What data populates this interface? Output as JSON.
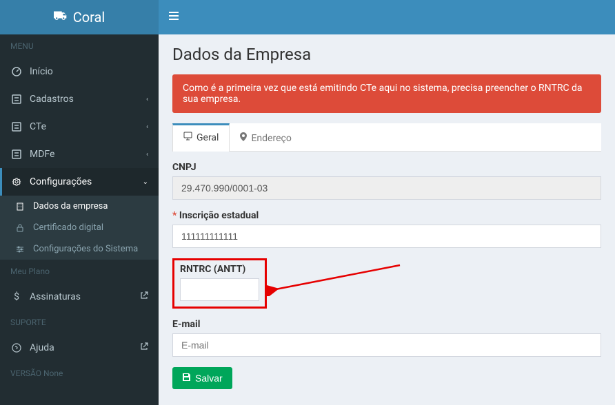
{
  "brand": "Coral",
  "sidebar": {
    "menu_label": "MENU",
    "items": {
      "inicio": "Início",
      "cadastros": "Cadastros",
      "cte": "CTe",
      "mdfe": "MDFe",
      "config": "Configurações"
    },
    "config_sub": {
      "dados": "Dados da empresa",
      "cert": "Certificado digital",
      "sys": "Configurações do Sistema"
    },
    "plano_label": "Meu Plano",
    "assinaturas": "Assinaturas",
    "suporte_label": "SUPORTE",
    "ajuda": "Ajuda",
    "version": "VERSÃO None"
  },
  "page": {
    "title": "Dados da Empresa",
    "alert": "Como é a primeira vez que está emitindo CTe aqui no sistema, precisa preencher o RNTRC da sua empresa."
  },
  "tabs": {
    "geral": "Geral",
    "endereco": "Endereço"
  },
  "form": {
    "cnpj_label": "CNPJ",
    "cnpj_value": "29.470.990/0001-03",
    "ie_label": "Inscrição estadual",
    "ie_value": "111111111111",
    "rntrc_label": "RNTRC (ANTT)",
    "rntrc_value": "",
    "email_label": "E-mail",
    "email_placeholder": "E-mail",
    "email_value": "",
    "save": "Salvar"
  }
}
